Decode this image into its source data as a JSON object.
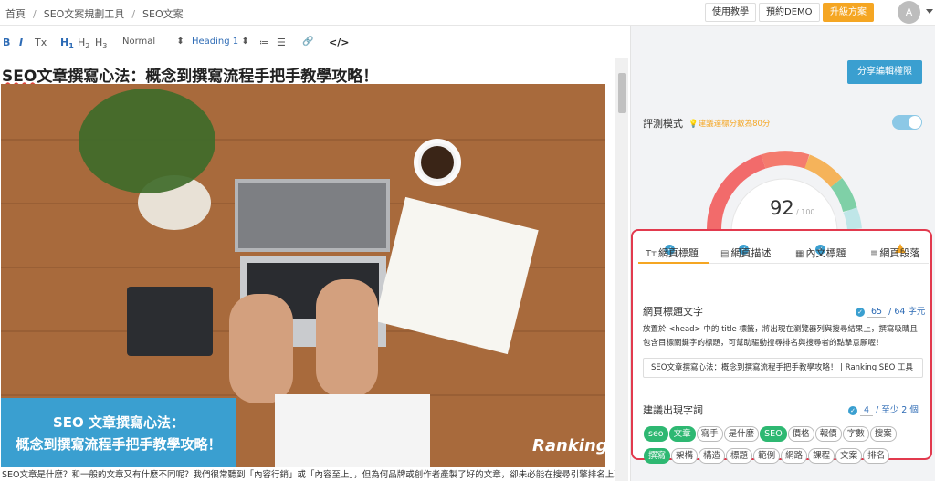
{
  "breadcrumb": [
    "首頁",
    "SEO文案規劃工具",
    "SEO文案"
  ],
  "header": {
    "tutorial_label": "使用教學",
    "demo_label": "預約DEMO",
    "upgrade_label": "升級方案",
    "avatar_letter": "A"
  },
  "toolbar": {
    "bold": "B",
    "italic": "I",
    "clear": "Tx",
    "h1": "H",
    "h2": "H",
    "h3": "H",
    "h1_sub": "1",
    "h2_sub": "2",
    "h3_sub": "3",
    "format_value": "Normal",
    "heading_value": "Heading 1",
    "ordered_list": "≔",
    "bullet_list": "☰",
    "link": "🔗",
    "code": "</>"
  },
  "editor": {
    "title_sq": "SEO",
    "title_rest": "文章撰寫心法：概念到撰寫流程手把手教學攻略！",
    "caption_line1": "SEO 文章撰寫心法：",
    "caption_line2": "概念到撰寫流程手把手教學攻略！",
    "brand": "Ranking",
    "body": "SEO文章是什麼？和一般的文章又有什麼不同呢？我們很常聽到「內容行銷」或「內容至上」，但為何品牌或創作者產製了好的文章，卻未必能在搜尋引擎排名上取得成效"
  },
  "panel": {
    "share_label": "分享編輯權限",
    "mode_label": "評測模式",
    "mode_tip": "建議達標分數為80分",
    "score": "92",
    "score_max": "/ 100",
    "tabs": [
      {
        "icon": "Tт",
        "label": "網頁標題"
      },
      {
        "icon": "▤",
        "label": "網頁描述"
      },
      {
        "icon": "▦",
        "label": "內文標題"
      },
      {
        "icon": "≣",
        "label": "網頁段落"
      }
    ],
    "title_section": {
      "label": "網頁標題文字",
      "current": "65",
      "limit": "/ 64 字元",
      "desc": "放置於 <head> 中的 title 標籤，將出現在瀏覽器列與搜尋結果上，撰寫吸睛且包含目標關鍵字的標題，可幫助驅動搜尋排名與搜尋者的點擊意願喔！",
      "value": "SEO文章撰寫心法：概念到撰寫流程手把手教學攻略！ | Ranking SEO 工具"
    },
    "keyword_section": {
      "label": "建議出現字詞",
      "current": "4",
      "limit": "/ 至少 2 個",
      "keywords": [
        {
          "text": "seo",
          "on": true
        },
        {
          "text": "文章",
          "on": true
        },
        {
          "text": "寫手",
          "on": false
        },
        {
          "text": "是什麼",
          "on": false
        },
        {
          "text": "SEO",
          "on": true
        },
        {
          "text": "價格",
          "on": false
        },
        {
          "text": "報價",
          "on": false
        },
        {
          "text": "字數",
          "on": false
        },
        {
          "text": "搜案",
          "on": false
        },
        {
          "text": "撰寫",
          "on": true
        },
        {
          "text": "架構",
          "on": false
        },
        {
          "text": "構造",
          "on": false
        },
        {
          "text": "標題",
          "on": false
        },
        {
          "text": "範例",
          "on": false
        },
        {
          "text": "網路",
          "on": false
        },
        {
          "text": "課程",
          "on": false
        },
        {
          "text": "文案",
          "on": false
        },
        {
          "text": "排名",
          "on": false
        }
      ]
    }
  }
}
